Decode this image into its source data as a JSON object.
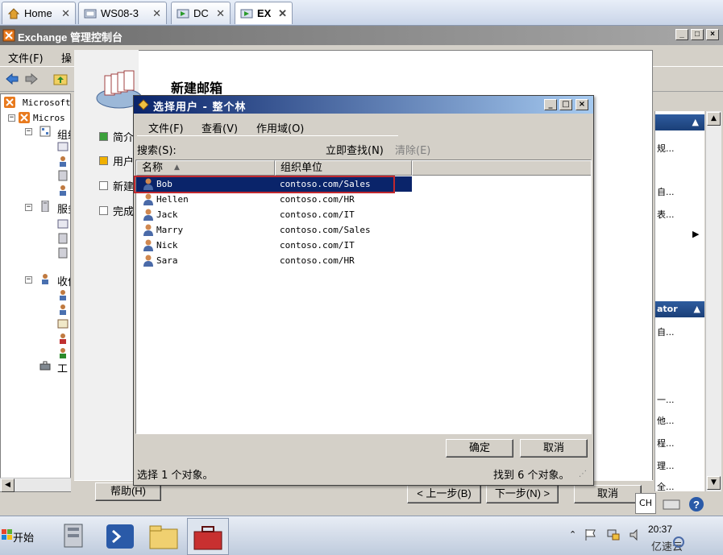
{
  "vm_tabs": [
    {
      "label": "Home",
      "icon": "home-icon"
    },
    {
      "label": "WS08-3",
      "icon": "vm-icon"
    },
    {
      "label": "DC",
      "icon": "vm-running-icon"
    },
    {
      "label": "EX",
      "icon": "vm-running-icon"
    }
  ],
  "tab_close_glyph": "✕",
  "console": {
    "title": "Exchange 管理控制台",
    "menu": [
      "文件(F)",
      "操"
    ],
    "tree": [
      {
        "label": "Microsoft"
      },
      {
        "label": "Micros"
      },
      {
        "label": "组织"
      },
      {
        "label": "服务"
      },
      {
        "label": "收件"
      },
      {
        "label": "工"
      }
    ],
    "actions_partial": [
      "规...",
      "自...",
      "表...",
      "ator",
      "自...",
      "一...",
      "他...",
      "程...",
      "理...",
      "全..."
    ]
  },
  "wizard": {
    "title": "新建邮箱",
    "steps": [
      "简介",
      "用户",
      "新建",
      "完成"
    ],
    "help_button": "帮助(H)",
    "back_button": "< 上一步(B)",
    "next_button": "下一步(N) >",
    "cancel_button": "取消"
  },
  "dialog": {
    "title": "选择用户 - 整个林",
    "menu": [
      "文件(F)",
      "查看(V)",
      "作用域(O)"
    ],
    "search_label": "搜索(S):",
    "find_now": "立即查找(N)",
    "clear": "清除(E)",
    "columns": [
      "名称",
      "组织单位"
    ],
    "users": [
      {
        "name": "Bob",
        "ou": "contoso.com/Sales",
        "selected": true
      },
      {
        "name": "Hellen",
        "ou": "contoso.com/HR",
        "selected": false
      },
      {
        "name": "Jack",
        "ou": "contoso.com/IT",
        "selected": false
      },
      {
        "name": "Marry",
        "ou": "contoso.com/Sales",
        "selected": false
      },
      {
        "name": "Nick",
        "ou": "contoso.com/IT",
        "selected": false
      },
      {
        "name": "Sara",
        "ou": "contoso.com/HR",
        "selected": false
      }
    ],
    "ok_button": "确定",
    "cancel_button": "取消",
    "status_selected": "选择 1 个对象。",
    "status_found": "找到 6 个对象。"
  },
  "taskbar": {
    "start": "开始",
    "clock": "20:37",
    "lang": "CH"
  },
  "watermark": "亿速云",
  "colors": {
    "selection": "#0a246a",
    "highlight_box": "#c0282e",
    "title_active": "#0a246a"
  }
}
